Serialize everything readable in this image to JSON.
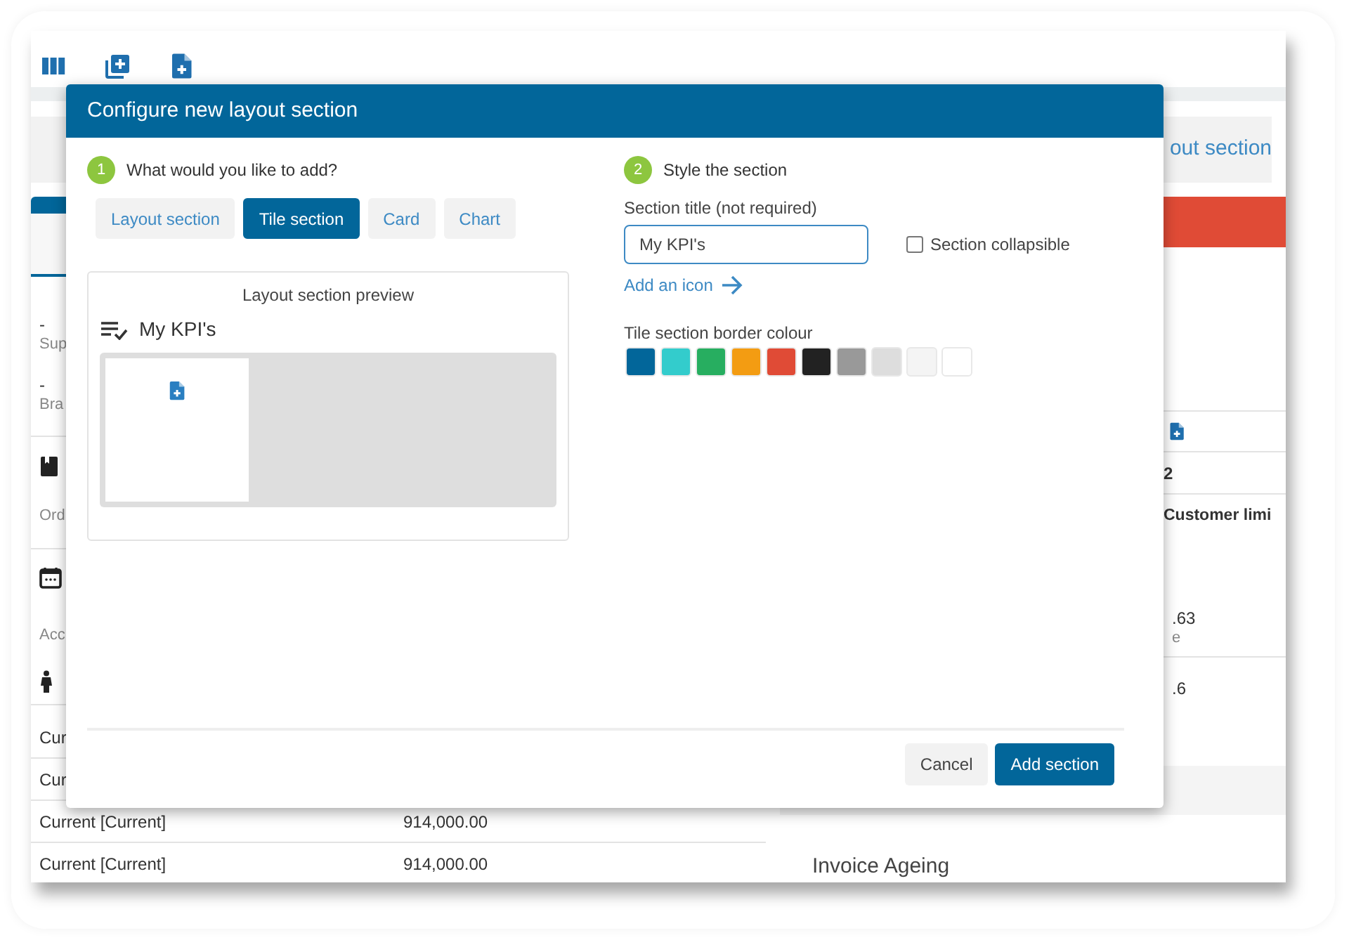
{
  "background": {
    "left_fields": [
      {
        "value": "-",
        "label": "Sup"
      },
      {
        "value": "-",
        "label": "Bra"
      }
    ],
    "left_icon_fields": [
      {
        "kind": "book",
        "label": "Ord"
      },
      {
        "kind": "calendar",
        "label": "Acc"
      },
      {
        "kind": "person"
      }
    ],
    "left_table": [
      {
        "column_1": "Cur"
      },
      {
        "column_1": "Cur"
      },
      {
        "column_1": "Current [Current]",
        "column_2": "914,000.00"
      },
      {
        "column_1": "Current [Current]",
        "column_2": "914,000.00"
      }
    ],
    "right_panel": {
      "heading": "out section",
      "count": "2",
      "column_header": "Customer limi",
      "values": [
        {
          "value": ".63",
          "caption": "e"
        },
        {
          "value": ".6"
        }
      ],
      "chart_title": "Invoice Ageing"
    }
  },
  "modal": {
    "title": "Configure new layout section",
    "steps": [
      {
        "number": "1",
        "label": "What would you like to add?"
      },
      {
        "number": "2",
        "label": "Style the section"
      }
    ],
    "types": [
      {
        "label": "Layout section",
        "selected": false
      },
      {
        "label": "Tile section",
        "selected": true
      },
      {
        "label": "Card",
        "selected": false
      },
      {
        "label": "Chart",
        "selected": false
      }
    ],
    "preview": {
      "title": "Layout section preview",
      "section_title": "My KPI's"
    },
    "section_title_field": {
      "label": "Section title (not required)",
      "value": "My KPI's"
    },
    "collapsible": {
      "label": "Section collapsible",
      "checked": false
    },
    "add_icon_link": "Add an icon",
    "border_colour": {
      "label": "Tile section border colour",
      "swatches": [
        {
          "color": "#02669a"
        },
        {
          "color": "#33cccc"
        },
        {
          "color": "#27ae60"
        },
        {
          "color": "#f39c12"
        },
        {
          "color": "#e04b36"
        },
        {
          "color": "#222222"
        },
        {
          "color": "#999999"
        },
        {
          "color": "#dddddd"
        },
        {
          "color": "#f4f4f4"
        },
        {
          "color": "#ffffff"
        }
      ]
    },
    "buttons": [
      {
        "label": "Cancel",
        "kind": "secondary"
      },
      {
        "label": "Add section",
        "kind": "primary"
      }
    ]
  }
}
